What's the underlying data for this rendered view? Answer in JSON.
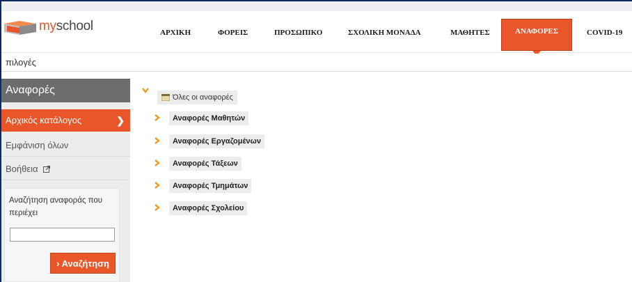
{
  "app": {
    "logo_my": "my",
    "logo_school": "school",
    "accent_color": "#e8562a",
    "logo_icon": "stacked-books-icon"
  },
  "nav": {
    "items": [
      {
        "label": "ΑΡΧΙΚΗ",
        "active": false
      },
      {
        "label": "ΦΟΡΕΙΣ",
        "active": false
      },
      {
        "label": "ΠΡΟΣΩΠΙΚΟ",
        "active": false
      },
      {
        "label": "ΣΧΟΛΙΚΗ ΜΟΝΑΔΑ",
        "active": false
      },
      {
        "label": "ΜΑΘΗΤΕΣ",
        "active": false
      },
      {
        "label": "ΑΝΑΦΟΡΕΣ",
        "active": true
      },
      {
        "label": "COVID-19",
        "active": false
      }
    ]
  },
  "subbar": {
    "text": "πιλογές"
  },
  "sidebar": {
    "heading": "Αναφορές",
    "items": [
      {
        "label": "Αρχικός κατάλογος",
        "active": true,
        "icon": "chevron-right-icon"
      },
      {
        "label": "Εμφάνιση όλων",
        "active": false
      },
      {
        "label": "Βοήθεια",
        "active": false,
        "icon": "external-link-icon"
      }
    ],
    "search": {
      "label": "Αναζήτηση αναφοράς που περιέχει",
      "value": "",
      "button_label": "Αναζήτηση",
      "button_icon": "chevron-right-icon"
    }
  },
  "tree": {
    "root": {
      "label": "Όλες οι αναφορές",
      "expanded": true,
      "icon": "folder-icon",
      "toggle_icon": "chevron-down-icon"
    },
    "items": [
      {
        "label": "Αναφορές Μαθητών",
        "icon": "chevron-right-icon"
      },
      {
        "label": "Αναφορές Εργαζομένων",
        "icon": "chevron-right-icon"
      },
      {
        "label": "Αναφορές Τάξεων",
        "icon": "chevron-right-icon"
      },
      {
        "label": "Αναφορές Τμημάτων",
        "icon": "chevron-right-icon"
      },
      {
        "label": "Αναφορές Σχολείου",
        "icon": "chevron-right-icon"
      }
    ]
  }
}
